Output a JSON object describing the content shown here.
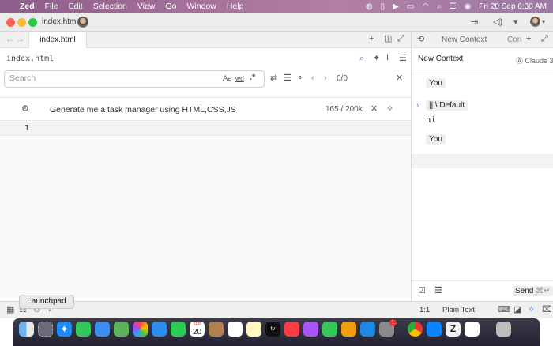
{
  "menubar": {
    "app": "Zed",
    "items": [
      "File",
      "Edit",
      "Selection",
      "View",
      "Go",
      "Window",
      "Help"
    ],
    "datetime": "Fri 20 Sep  6:30 AM"
  },
  "window": {
    "title": "index.html"
  },
  "tabbar": {
    "active_tab": "index.html"
  },
  "editor": {
    "filename": "index.html",
    "search": {
      "placeholder": "Search",
      "case_label": "Aa",
      "word_label": "wd",
      "regex_label": ".*",
      "match_count": "0/0"
    },
    "inline_assist": {
      "prompt": "Generate me a task manager using HTML,CSS,JS",
      "tokens": "165 / 200k"
    },
    "line_number": "1"
  },
  "assistant": {
    "tab_label": "New Context",
    "tab_label_2": "Con",
    "header": "New Context",
    "model": "Claude 3.",
    "messages": [
      {
        "role": "You"
      },
      {
        "command": "Default",
        "text": "hi"
      },
      {
        "role": "You"
      }
    ],
    "send_label": "Send",
    "send_shortcut": "⌘↵"
  },
  "statusbar": {
    "position": "1:1",
    "language": "Plain Text"
  },
  "dock": {
    "tooltip": "Launchpad",
    "calendar_month": "SEP",
    "calendar_day": "20",
    "badge": "1"
  },
  "colors": {
    "menubar_bg": "#9c6e98",
    "accent": "#3b82f6",
    "close": "#ff5f57",
    "minimize": "#febc2e",
    "zoom": "#28c840"
  }
}
